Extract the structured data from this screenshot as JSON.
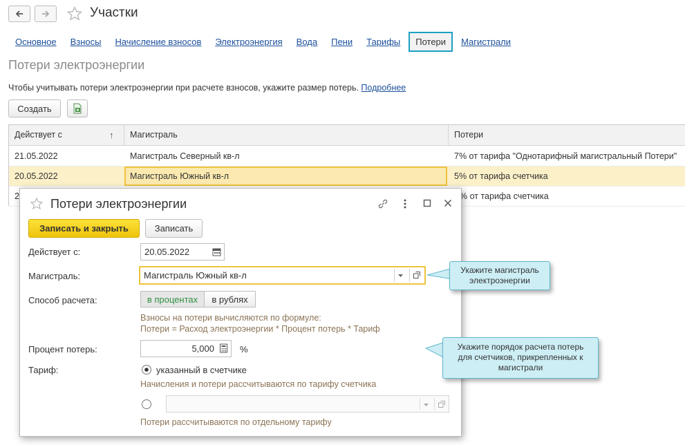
{
  "header": {
    "title": "Участки"
  },
  "tabs": [
    {
      "label": "Основное"
    },
    {
      "label": "Взносы"
    },
    {
      "label": "Начисление взносов"
    },
    {
      "label": "Электроэнергия"
    },
    {
      "label": "Вода"
    },
    {
      "label": "Пени"
    },
    {
      "label": "Тарифы"
    },
    {
      "label": "Потери",
      "active": true
    },
    {
      "label": "Магистрали"
    }
  ],
  "section": {
    "title": "Потери электроэнергии",
    "hint": "Чтобы учитывать потери электроэнергии при расчете взносов, укажите размер потерь.",
    "more_link": "Подробнее"
  },
  "toolbar": {
    "create": "Создать"
  },
  "table": {
    "columns": [
      "Действует с",
      "Магистраль",
      "Потери"
    ],
    "sort_mark": "↑",
    "rows": [
      {
        "date": "21.05.2022",
        "line": "Магистраль Северный кв-л",
        "loss": "7% от тарифа \"Однотарифный магистральный Потери\""
      },
      {
        "date": "20.05.2022",
        "line": "Магистраль Южный кв-л",
        "loss": "5% от тарифа счетчика"
      },
      {
        "date": "2",
        "line": "",
        "loss": "% от тарифа счетчика"
      }
    ]
  },
  "dialog": {
    "title": "Потери электроэнергии",
    "save_close": "Записать и закрыть",
    "save": "Записать",
    "date_label": "Действует с:",
    "date_value": "20.05.2022",
    "line_label": "Магистраль:",
    "line_value": "Магистраль Южный кв-л",
    "method_label": "Способ расчета:",
    "method_percent": "в процентах",
    "method_rub": "в рублях",
    "formula_line1": "Взносы на потери вычисляются по формуле:",
    "formula_line2": "Потери = Расход электроэнергии * Процент потерь * Тариф",
    "percent_label": "Процент потерь:",
    "percent_value": "5,000",
    "percent_unit": "%",
    "tariff_label": "Тариф:",
    "tariff_option1": "указанный в счетчике",
    "tariff_note1": "Начисления и потери рассчитываются по тарифу счетчика",
    "tariff_note2": "Потери рассчитываются по отдельному тарифу"
  },
  "callouts": {
    "line": "Укажите магистраль электроэнергии",
    "tariff": "Укажите порядок расчета потерь для счетчиков, прикрепленных к магистрали"
  },
  "colors": {
    "accent": "#1aa1c2",
    "primary_button": "#f5d30f",
    "selected_row": "#fcf0c8",
    "link": "#1b4f9b"
  }
}
